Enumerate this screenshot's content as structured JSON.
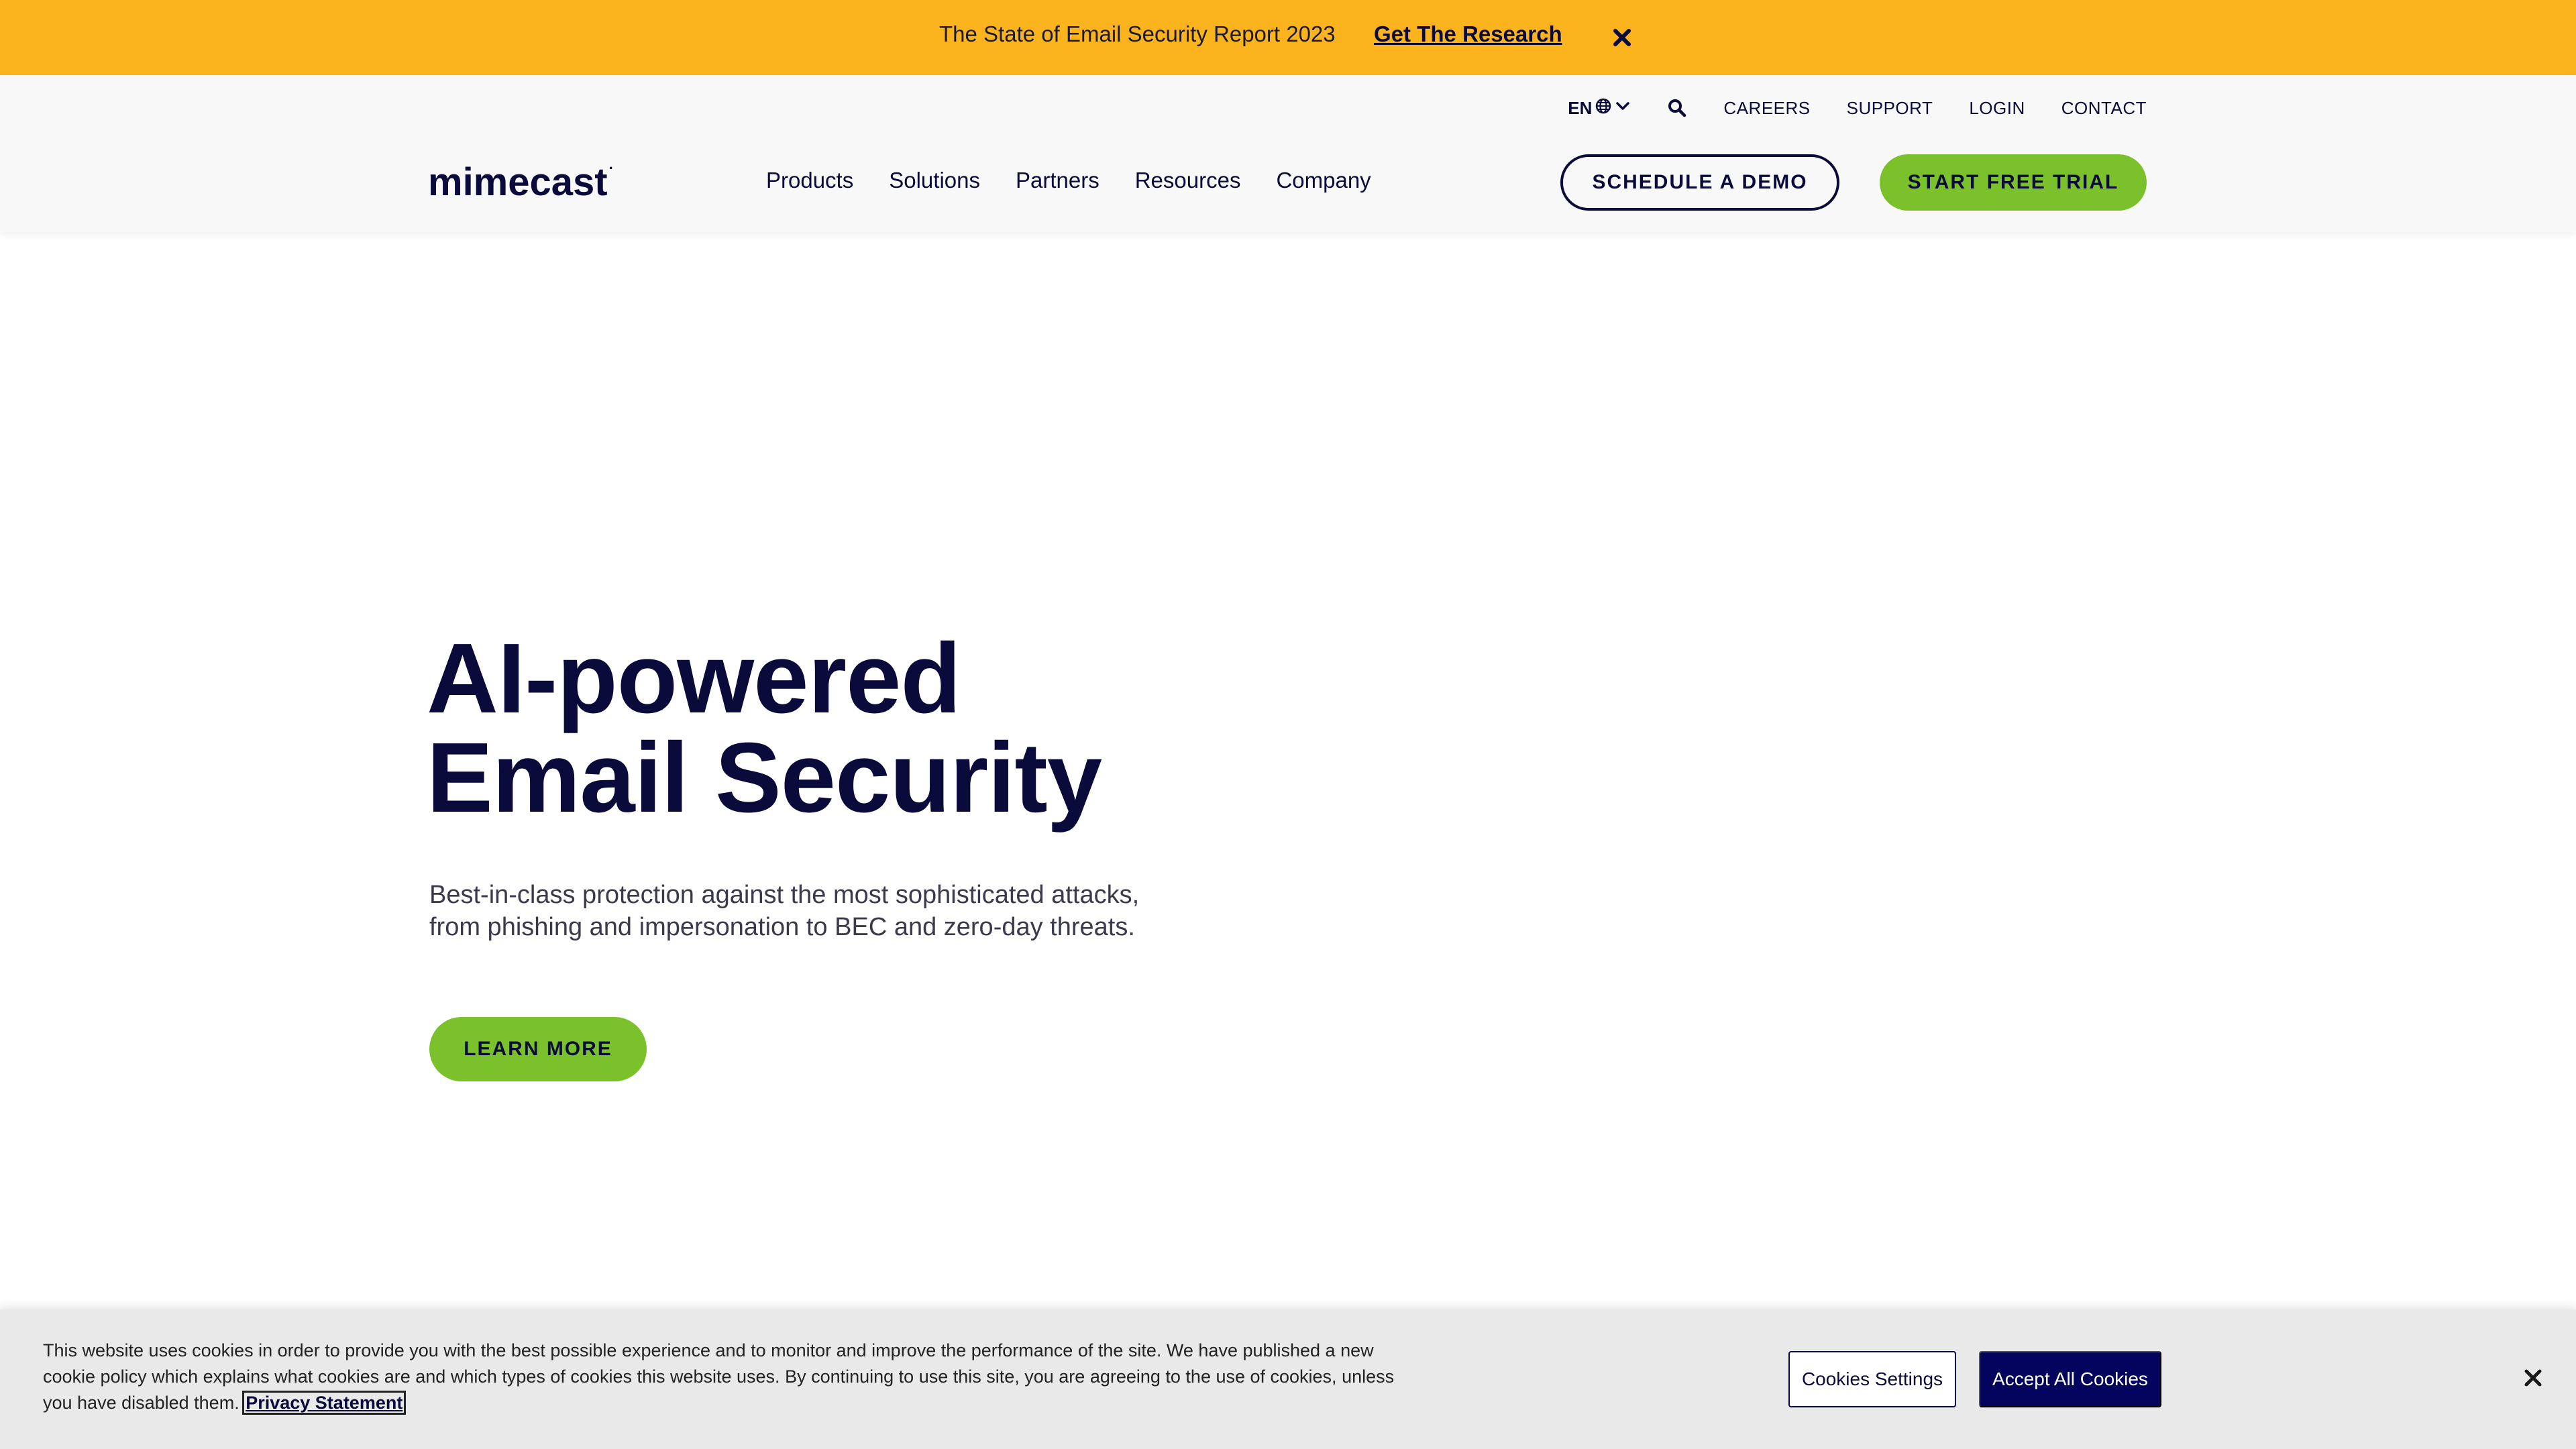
{
  "announcement": {
    "message": "The State of Email Security Report 2023",
    "cta_label": "Get The Research",
    "close_icon": "close-icon"
  },
  "utility_nav": {
    "language": "EN",
    "language_icons": [
      "globe-icon",
      "chevron-down-icon"
    ],
    "search_icon": "search-icon",
    "links": [
      "CAREERS",
      "SUPPORT",
      "LOGIN",
      "CONTACT"
    ]
  },
  "brand": {
    "logo_text": "mimecast",
    "logo_mark": "·"
  },
  "main_nav": {
    "items": [
      "Products",
      "Solutions",
      "Partners",
      "Resources",
      "Company"
    ]
  },
  "header_actions": {
    "demo_label": "SCHEDULE A DEMO",
    "trial_label": "START FREE TRIAL"
  },
  "hero": {
    "title_line1": "AI-powered",
    "title_line2": "Email Security",
    "subtitle": "Best-in-class protection against the most sophisticated attacks, from phishing and impersonation to BEC and zero-day threats.",
    "cta_label": "LEARN MORE"
  },
  "cookie_banner": {
    "text": "This website uses cookies in order to provide you with the best possible experience and to monitor and improve the performance of the site. We have published a new cookie policy which explains what cookies are and which types of cookies this website uses. By continuing to use this site, you are agreeing to the use of cookies, unless you have disabled them.",
    "privacy_link": "Privacy Statement",
    "settings_label": "Cookies Settings",
    "accept_label": "Accept All Cookies",
    "close_icon": "close-icon"
  },
  "colors": {
    "announcement_bg": "#fbb31e",
    "navy": "#0b0b3b",
    "green": "#7ac12b",
    "accept_button": "#03045e",
    "header_bg": "#f8f8f8",
    "cookie_bg": "#e9e9e9"
  }
}
